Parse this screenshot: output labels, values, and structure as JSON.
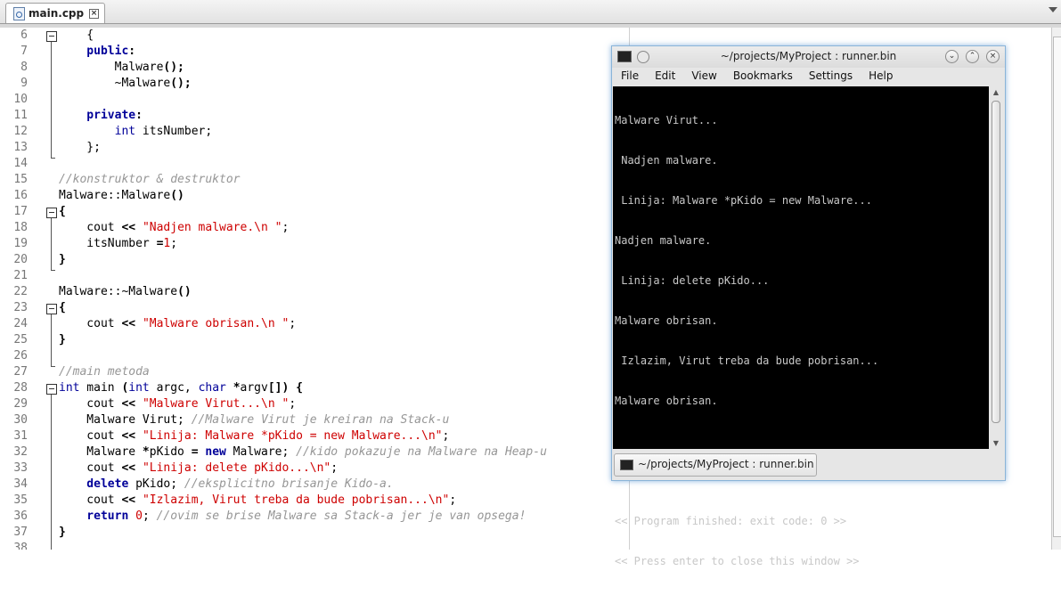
{
  "editor_tab": {
    "filename": "main.cpp",
    "file_icon": "cpp-file-icon",
    "close_icon": "close-tab-icon"
  },
  "lines": [
    {
      "n": "6",
      "code": [
        [
          "",
          "    {"
        ]
      ]
    },
    {
      "n": "7",
      "code": [
        [
          "kw",
          "    public"
        ],
        [
          "b",
          ":"
        ]
      ]
    },
    {
      "n": "8",
      "code": [
        [
          "",
          "        Malware"
        ],
        [
          "b",
          "();"
        ]
      ]
    },
    {
      "n": "9",
      "code": [
        [
          "",
          "        ~Malware"
        ],
        [
          "b",
          "();"
        ]
      ]
    },
    {
      "n": "10",
      "code": []
    },
    {
      "n": "11",
      "code": [
        [
          "kw",
          "    private"
        ],
        [
          "b",
          ":"
        ]
      ]
    },
    {
      "n": "12",
      "code": [
        [
          "ty",
          "        int"
        ],
        [
          "",
          " itsNumber;"
        ]
      ]
    },
    {
      "n": "13",
      "code": [
        [
          "",
          "    };"
        ]
      ]
    },
    {
      "n": "14",
      "code": []
    },
    {
      "n": "15",
      "code": [
        [
          "cm",
          "//konstruktor & destruktor"
        ]
      ]
    },
    {
      "n": "16",
      "code": [
        [
          "",
          "Malware::Malware"
        ],
        [
          "b",
          "()"
        ]
      ]
    },
    {
      "n": "17",
      "code": [
        [
          "b",
          "{"
        ]
      ]
    },
    {
      "n": "18",
      "code": [
        [
          "",
          "    cout "
        ],
        [
          "b",
          "<<"
        ],
        [
          "",
          " "
        ],
        [
          "str",
          "\"Nadjen malware.\\n \""
        ],
        [
          "",
          ";"
        ]
      ]
    },
    {
      "n": "19",
      "code": [
        [
          "",
          "    itsNumber "
        ],
        [
          "b",
          "="
        ],
        [
          "num",
          "1"
        ],
        [
          "",
          ";"
        ]
      ]
    },
    {
      "n": "20",
      "code": [
        [
          "b",
          "}"
        ]
      ]
    },
    {
      "n": "21",
      "code": []
    },
    {
      "n": "22",
      "code": [
        [
          "",
          "Malware::~Malware"
        ],
        [
          "b",
          "()"
        ]
      ]
    },
    {
      "n": "23",
      "code": [
        [
          "b",
          "{"
        ]
      ]
    },
    {
      "n": "24",
      "code": [
        [
          "",
          "    cout "
        ],
        [
          "b",
          "<<"
        ],
        [
          "",
          " "
        ],
        [
          "str",
          "\"Malware obrisan.\\n \""
        ],
        [
          "",
          ";"
        ]
      ]
    },
    {
      "n": "25",
      "code": [
        [
          "b",
          "}"
        ]
      ]
    },
    {
      "n": "26",
      "code": []
    },
    {
      "n": "27",
      "code": [
        [
          "cm",
          "//main metoda"
        ]
      ]
    },
    {
      "n": "28",
      "code": [
        [
          "ty",
          "int"
        ],
        [
          "",
          " main "
        ],
        [
          "b",
          "("
        ],
        [
          "ty",
          "int"
        ],
        [
          "",
          " argc, "
        ],
        [
          "ty",
          "char"
        ],
        [
          "",
          " "
        ],
        [
          "b",
          "*"
        ],
        [
          "",
          "argv"
        ],
        [
          "b",
          "[])"
        ],
        [
          "",
          " "
        ],
        [
          "b",
          "{"
        ]
      ]
    },
    {
      "n": "29",
      "code": [
        [
          "",
          "    cout "
        ],
        [
          "b",
          "<<"
        ],
        [
          "",
          " "
        ],
        [
          "str",
          "\"Malware Virut...\\n \""
        ],
        [
          "",
          ";"
        ]
      ]
    },
    {
      "n": "30",
      "code": [
        [
          "",
          "    Malware Virut; "
        ],
        [
          "cm",
          "//Malware Virut je kreiran na Stack-u"
        ]
      ]
    },
    {
      "n": "31",
      "code": [
        [
          "",
          "    cout "
        ],
        [
          "b",
          "<<"
        ],
        [
          "",
          " "
        ],
        [
          "str",
          "\"Linija: Malware *pKido = new Malware...\\n\""
        ],
        [
          "",
          ";"
        ]
      ]
    },
    {
      "n": "32",
      "code": [
        [
          "",
          "    Malware "
        ],
        [
          "b",
          "*"
        ],
        [
          "",
          "pKido "
        ],
        [
          "b",
          "="
        ],
        [
          "",
          " "
        ],
        [
          "kw",
          "new"
        ],
        [
          "",
          " Malware; "
        ],
        [
          "cm",
          "//kido pokazuje na Malware na Heap-u"
        ]
      ]
    },
    {
      "n": "33",
      "code": [
        [
          "",
          "    cout "
        ],
        [
          "b",
          "<<"
        ],
        [
          "",
          " "
        ],
        [
          "str",
          "\"Linija: delete pKido...\\n\""
        ],
        [
          "",
          ";"
        ]
      ]
    },
    {
      "n": "34",
      "code": [
        [
          "kw",
          "    delete"
        ],
        [
          "",
          " pKido; "
        ],
        [
          "cm",
          "//eksplicitno brisanje Kido-a."
        ]
      ]
    },
    {
      "n": "35",
      "code": [
        [
          "",
          "    cout "
        ],
        [
          "b",
          "<<"
        ],
        [
          "",
          " "
        ],
        [
          "str",
          "\"Izlazim, Virut treba da bude pobrisan...\\n\""
        ],
        [
          "",
          ";"
        ]
      ]
    },
    {
      "n": "36",
      "code": [
        [
          "kw",
          "    return"
        ],
        [
          "",
          " "
        ],
        [
          "num",
          "0"
        ],
        [
          "",
          "; "
        ],
        [
          "cm",
          "//ovim se brise Malware sa Stack-a jer je van opsega!"
        ]
      ]
    },
    {
      "n": "37",
      "code": [
        [
          "b",
          "}"
        ]
      ]
    },
    {
      "n": "38",
      "code": []
    }
  ],
  "terminal": {
    "title": "~/projects/MyProject : runner.bin",
    "menu": [
      "File",
      "Edit",
      "View",
      "Bookmarks",
      "Settings",
      "Help"
    ],
    "output": [
      "Malware Virut...",
      " Nadjen malware.",
      " Linija: Malware *pKido = new Malware...",
      "Nadjen malware.",
      " Linija: delete pKido...",
      "Malware obrisan.",
      " Izlazim, Virut treba da bude pobrisan...",
      "Malware obrisan.",
      "",
      "",
      "<< Program finished: exit code: 0 >>",
      "<< Press enter to close this window >>"
    ],
    "tab_label": "~/projects/MyProject : runner.bin",
    "window_icon": "terminal-icon",
    "buttons": [
      "minimize-button",
      "maximize-button",
      "close-button"
    ]
  }
}
